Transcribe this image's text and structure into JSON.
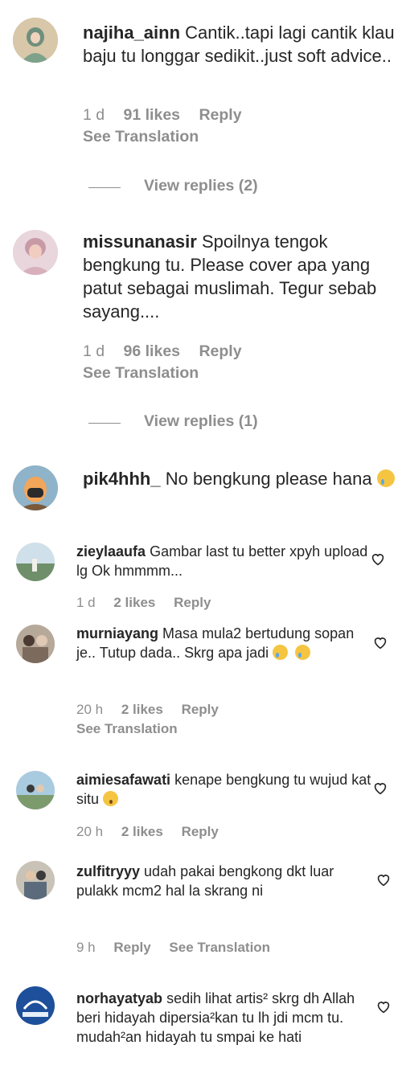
{
  "comments_primary": [
    {
      "username": "najiha_ainn",
      "text": "Cantik..tapi lagi cantik klau baju tu longgar sedikit..just soft advice..",
      "time": "1 d",
      "likes": "91 likes",
      "reply": "Reply",
      "see_translation": "See Translation",
      "view_replies": "View replies (2)"
    },
    {
      "username": "missunanasir",
      "text": "Spoilnya tengok bengkung tu. Please cover apa yang patut sebagai muslimah. Tegur sebab sayang....",
      "time": "1 d",
      "likes": "96 likes",
      "reply": "Reply",
      "see_translation": "See Translation",
      "view_replies": "View replies (1)"
    },
    {
      "username": "pik4hhh_",
      "text": "No bengkung please hana",
      "emoji": "crying-face"
    }
  ],
  "comments_secondary": [
    {
      "username": "zieylaaufa",
      "text": "Gambar last tu better xpyh upload lg Ok hmmmm...",
      "time": "1 d",
      "likes": "2 likes",
      "reply": "Reply"
    },
    {
      "username": "murniayang",
      "text": "Masa mula2 bertudung sopan je.. Tutup dada.. Skrg apa jadi",
      "emoji": "crying-face",
      "time": "20 h",
      "likes": "2 likes",
      "reply": "Reply",
      "see_translation": "See Translation"
    },
    {
      "username": "aimiesafawati",
      "text": "kenape bengkung tu wujud kat situ",
      "emoji": "surprised-face",
      "time": "20 h",
      "likes": "2 likes",
      "reply": "Reply"
    },
    {
      "username": "zulfitryyy",
      "text": "udah pakai bengkong dkt luar pulakk mcm2 hal la skrang ni",
      "time": "9 h",
      "reply": "Reply",
      "see_translation": "See Translation"
    },
    {
      "username": "norhayatyab",
      "text": "sedih lihat artis² skrg dh Allah beri hidayah dipersia²kan tu lh jdi mcm tu. mudah²an hidayah tu smpai ke hati"
    }
  ],
  "colors": {
    "text": "#262626",
    "secondary": "#8e8e8e",
    "background": "#ffffff"
  }
}
